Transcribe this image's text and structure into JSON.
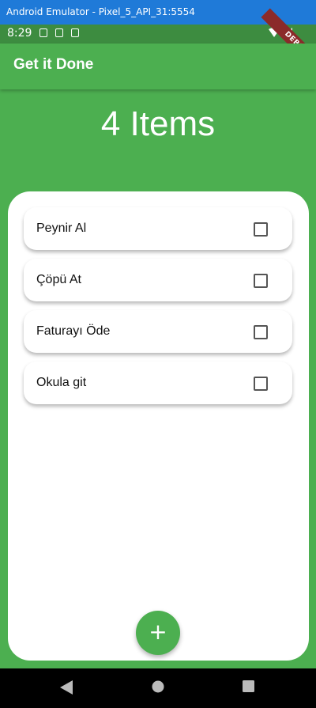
{
  "window": {
    "title": "Android Emulator - Pixel_5_API_31:5554"
  },
  "status_bar": {
    "time": "8:29",
    "debug_label": "DEBUG"
  },
  "app_bar": {
    "title": "Get it Done"
  },
  "summary": {
    "item_count_text": "4 Items"
  },
  "todos": [
    {
      "label": "Peynir Al",
      "checked": false
    },
    {
      "label": "Çöpü At",
      "checked": false
    },
    {
      "label": "Faturayı Öde",
      "checked": false
    },
    {
      "label": "Okula git",
      "checked": false
    }
  ],
  "fab": {
    "icon": "plus-icon",
    "glyph": "+"
  },
  "colors": {
    "primary": "#4caf50",
    "status_bar": "#3d8c40",
    "window_title_bar": "#1f7ad8"
  }
}
